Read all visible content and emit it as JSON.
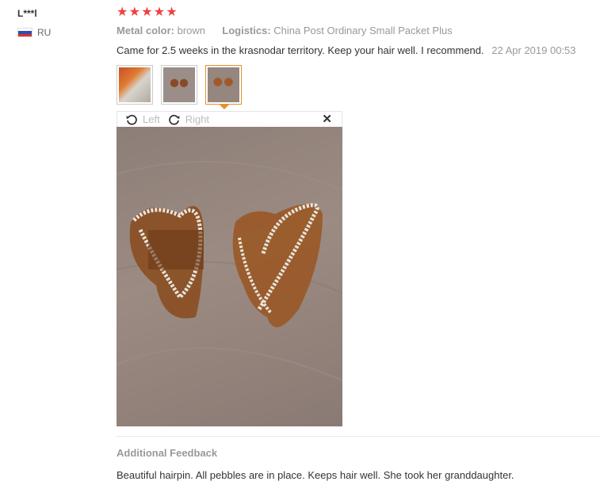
{
  "user": {
    "name": "L***l",
    "country": "RU",
    "flag_colors": [
      "#ffffff",
      "#2b4fb3",
      "#d8322e"
    ]
  },
  "review": {
    "rating": 5,
    "stars": [
      "★",
      "★",
      "★",
      "★",
      "★"
    ],
    "star_color": "#f04040",
    "metal_label": "Metal color:",
    "metal_value": "brown",
    "logistics_label": "Logistics:",
    "logistics_value": "China Post Ordinary Small Packet Plus",
    "comment": "Came for 2.5 weeks in the krasnodar territory. Keep your hair well. I recommend.",
    "date": "22 Apr 2019 00:53",
    "active_thumb_color": "#e8902a"
  },
  "thumbnails": [
    {
      "icon": "photo-thumbnail-1"
    },
    {
      "icon": "photo-thumbnail-2"
    },
    {
      "icon": "photo-thumbnail-3",
      "active": true
    }
  ],
  "viewer": {
    "rotate_left_label": "Left",
    "rotate_right_label": "Right",
    "close_symbol": "✕"
  },
  "additional": {
    "title": "Additional Feedback",
    "text": "Beautiful hairpin. All pebbles are in place. Keeps hair well. She took her granddaughter."
  }
}
